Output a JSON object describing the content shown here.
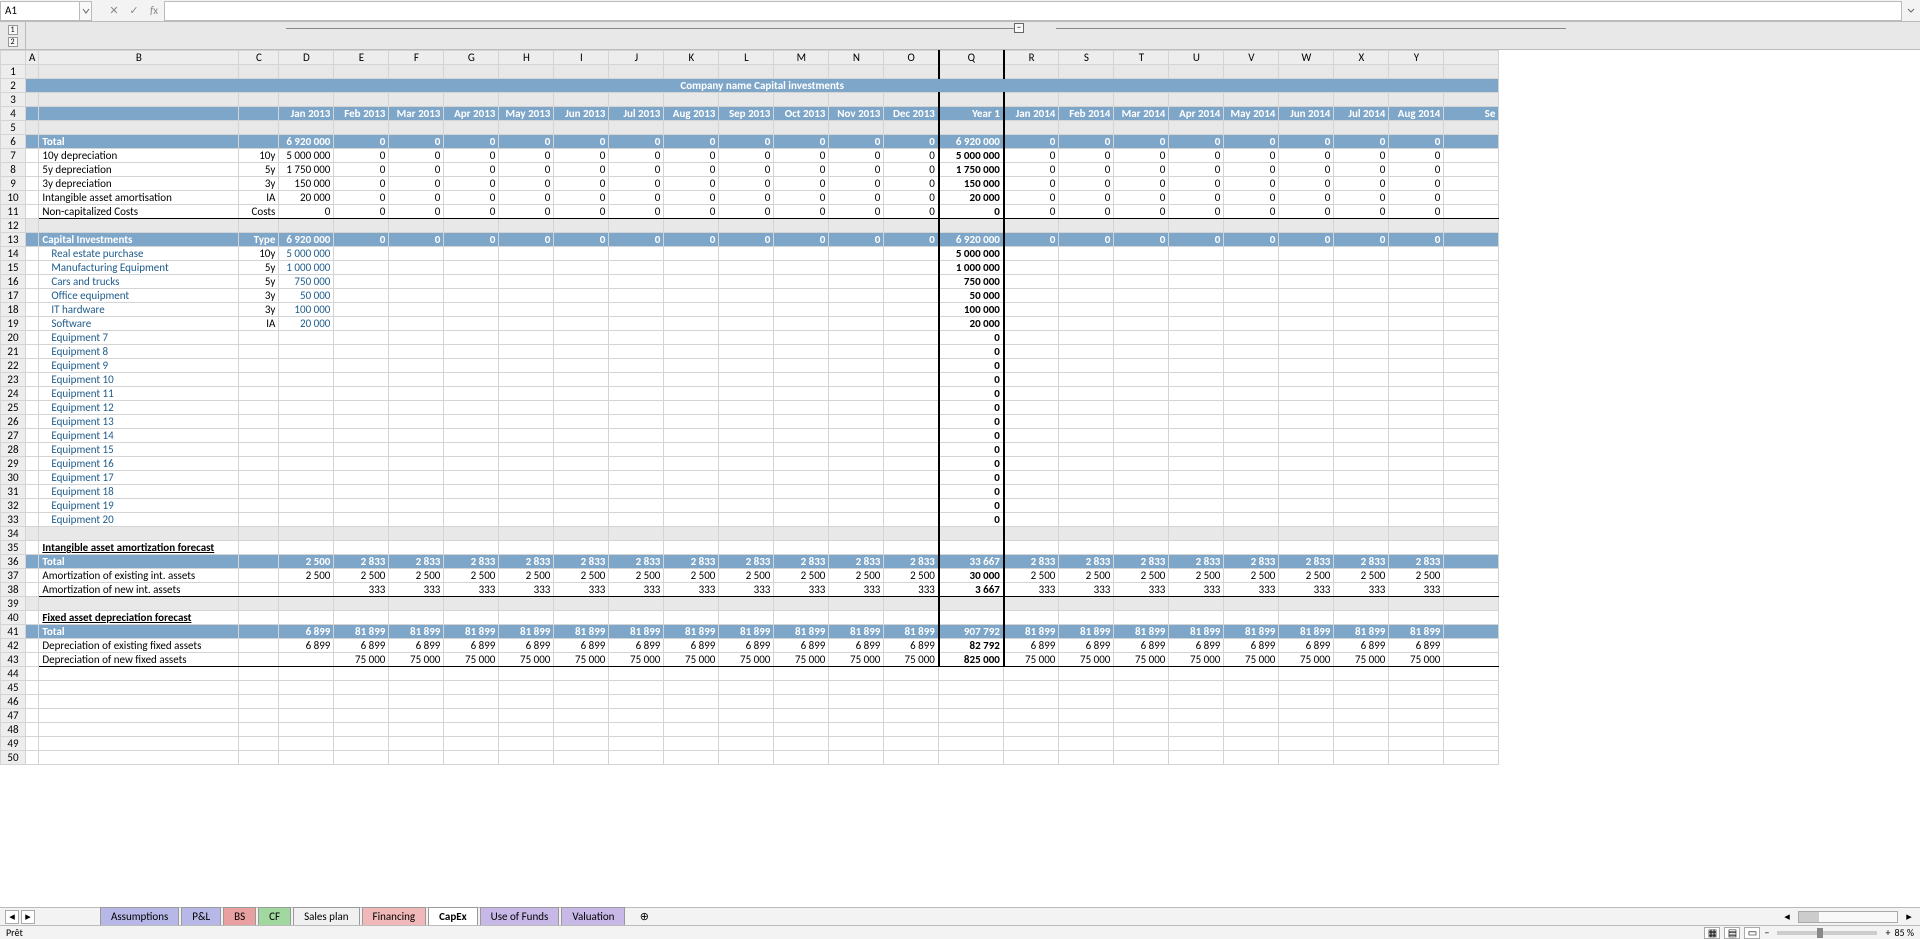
{
  "namebox": "A1",
  "title": "Company name Capital investments",
  "columns": [
    "A",
    "B",
    "C",
    "D",
    "E",
    "F",
    "G",
    "H",
    "I",
    "J",
    "K",
    "L",
    "M",
    "N",
    "O",
    "Q",
    "R",
    "S",
    "T",
    "U",
    "V",
    "W",
    "X"
  ],
  "month_headers": [
    "Jan 2013",
    "Feb 2013",
    "Mar 2013",
    "Apr 2013",
    "May 2013",
    "Jun 2013",
    "Jul 2013",
    "Aug 2013",
    "Sep 2013",
    "Oct 2013",
    "Nov 2013",
    "Dec 2013"
  ],
  "year1_label": "Year 1",
  "month_headers_2014": [
    "Jan 2014",
    "Feb 2014",
    "Mar 2014",
    "Apr 2014",
    "May 2014",
    "Jun 2014",
    "Jul 2014",
    "Aug 2014"
  ],
  "partial_last": "Se",
  "total_label": "Total",
  "total_row": [
    "6 920 000",
    "0",
    "0",
    "0",
    "0",
    "0",
    "0",
    "0",
    "0",
    "0",
    "0",
    "0",
    "6 920 000",
    "0",
    "0",
    "0",
    "0",
    "0",
    "0",
    "0",
    "0"
  ],
  "dep_rows": [
    {
      "label": "10y depreciation",
      "type": "10y",
      "jan": "5 000 000",
      "zeros": 11,
      "year": "5 000 000",
      "zeros2": 8
    },
    {
      "label": "5y depreciation",
      "type": "5y",
      "jan": "1 750 000",
      "zeros": 11,
      "year": "1 750 000",
      "zeros2": 8
    },
    {
      "label": "3y depreciation",
      "type": "3y",
      "jan": "150 000",
      "zeros": 11,
      "year": "150 000",
      "zeros2": 8
    },
    {
      "label": "Intangible asset amortisation",
      "type": "IA",
      "jan": "20 000",
      "zeros": 11,
      "year": "20 000",
      "zeros2": 8
    },
    {
      "label": "Non-capitalized Costs",
      "type": "Costs",
      "jan": "0",
      "zeros": 11,
      "year": "0",
      "zeros2": 8
    }
  ],
  "capinv_label": "Capital Investments",
  "type_label": "Type",
  "capinv_total": [
    "6 920 000",
    "0",
    "0",
    "0",
    "0",
    "0",
    "0",
    "0",
    "0",
    "0",
    "0",
    "0",
    "6 920 000",
    "0",
    "0",
    "0",
    "0",
    "0",
    "0",
    "0",
    "0"
  ],
  "capinv_rows": [
    {
      "label": "Real estate purchase",
      "type": "10y",
      "jan": "5 000 000",
      "year": "5 000 000"
    },
    {
      "label": "Manufacturing Equipment",
      "type": "5y",
      "jan": "1 000 000",
      "year": "1 000 000"
    },
    {
      "label": "Cars and trucks",
      "type": "5y",
      "jan": "750 000",
      "year": "750 000"
    },
    {
      "label": "Office equipment",
      "type": "3y",
      "jan": "50 000",
      "year": "50 000"
    },
    {
      "label": "IT hardware",
      "type": "3y",
      "jan": "100 000",
      "year": "100 000"
    },
    {
      "label": "Software",
      "type": "IA",
      "jan": "20 000",
      "year": "20 000"
    },
    {
      "label": "Equipment 7",
      "type": "",
      "jan": "",
      "year": "0"
    },
    {
      "label": "Equipment 8",
      "type": "",
      "jan": "",
      "year": "0"
    },
    {
      "label": "Equipment 9",
      "type": "",
      "jan": "",
      "year": "0"
    },
    {
      "label": "Equipment 10",
      "type": "",
      "jan": "",
      "year": "0"
    },
    {
      "label": "Equipment 11",
      "type": "",
      "jan": "",
      "year": "0"
    },
    {
      "label": "Equipment 12",
      "type": "",
      "jan": "",
      "year": "0"
    },
    {
      "label": "Equipment 13",
      "type": "",
      "jan": "",
      "year": "0"
    },
    {
      "label": "Equipment 14",
      "type": "",
      "jan": "",
      "year": "0"
    },
    {
      "label": "Equipment 15",
      "type": "",
      "jan": "",
      "year": "0"
    },
    {
      "label": "Equipment 16",
      "type": "",
      "jan": "",
      "year": "0"
    },
    {
      "label": "Equipment 17",
      "type": "",
      "jan": "",
      "year": "0"
    },
    {
      "label": "Equipment 18",
      "type": "",
      "jan": "",
      "year": "0"
    },
    {
      "label": "Equipment 19",
      "type": "",
      "jan": "",
      "year": "0"
    },
    {
      "label": "Equipment 20",
      "type": "",
      "jan": "",
      "year": "0"
    }
  ],
  "intang_hdr": "Intangible asset amortization forecast",
  "intang_total": [
    "2 500",
    "2 833",
    "2 833",
    "2 833",
    "2 833",
    "2 833",
    "2 833",
    "2 833",
    "2 833",
    "2 833",
    "2 833",
    "2 833",
    "33 667",
    "2 833",
    "2 833",
    "2 833",
    "2 833",
    "2 833",
    "2 833",
    "2 833",
    "2 833"
  ],
  "intang_exist": {
    "label": "Amortization of existing int. assets",
    "vals": [
      "2 500",
      "2 500",
      "2 500",
      "2 500",
      "2 500",
      "2 500",
      "2 500",
      "2 500",
      "2 500",
      "2 500",
      "2 500",
      "2 500",
      "30 000",
      "2 500",
      "2 500",
      "2 500",
      "2 500",
      "2 500",
      "2 500",
      "2 500",
      "2 500"
    ]
  },
  "intang_new": {
    "label": "Amortization of new int. assets",
    "vals": [
      "",
      "333",
      "333",
      "333",
      "333",
      "333",
      "333",
      "333",
      "333",
      "333",
      "333",
      "333",
      "3 667",
      "333",
      "333",
      "333",
      "333",
      "333",
      "333",
      "333",
      "333"
    ]
  },
  "fixed_hdr": "Fixed asset depreciation forecast",
  "fixed_total": [
    "6 899",
    "81 899",
    "81 899",
    "81 899",
    "81 899",
    "81 899",
    "81 899",
    "81 899",
    "81 899",
    "81 899",
    "81 899",
    "81 899",
    "907 792",
    "81 899",
    "81 899",
    "81 899",
    "81 899",
    "81 899",
    "81 899",
    "81 899",
    "81 899"
  ],
  "fixed_exist": {
    "label": "Depreciation of existing fixed assets",
    "vals": [
      "6 899",
      "6 899",
      "6 899",
      "6 899",
      "6 899",
      "6 899",
      "6 899",
      "6 899",
      "6 899",
      "6 899",
      "6 899",
      "6 899",
      "82 792",
      "6 899",
      "6 899",
      "6 899",
      "6 899",
      "6 899",
      "6 899",
      "6 899",
      "6 899"
    ]
  },
  "fixed_new": {
    "label": "Depreciation of new fixed assets",
    "vals": [
      "",
      "75 000",
      "75 000",
      "75 000",
      "75 000",
      "75 000",
      "75 000",
      "75 000",
      "75 000",
      "75 000",
      "75 000",
      "75 000",
      "825 000",
      "75 000",
      "75 000",
      "75 000",
      "75 000",
      "75 000",
      "75 000",
      "75 000",
      "75 000"
    ]
  },
  "tabs": [
    {
      "label": "Assumptions",
      "color": "#b8b8e8"
    },
    {
      "label": "P&L",
      "color": "#b8b8e8"
    },
    {
      "label": "BS",
      "color": "#e8a0a0"
    },
    {
      "label": "CF",
      "color": "#a0d8a0"
    },
    {
      "label": "Sales plan",
      "color": "#f0f0f0"
    },
    {
      "label": "Financing",
      "color": "#f0b8b8"
    },
    {
      "label": "CapEx",
      "color": "#ffffff",
      "active": true
    },
    {
      "label": "Use of Funds",
      "color": "#c8b8e8"
    },
    {
      "label": "Valuation",
      "color": "#c8b8e8"
    }
  ],
  "status_text": "Prêt",
  "zoom": "85 %"
}
